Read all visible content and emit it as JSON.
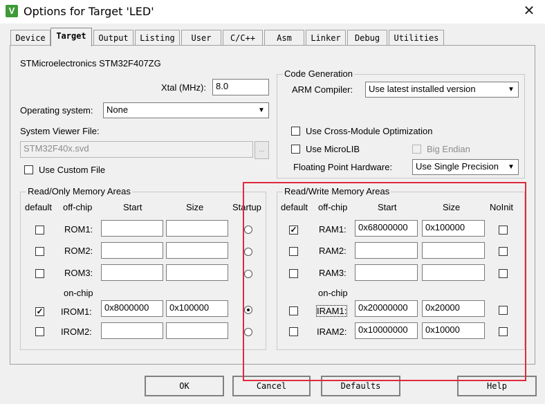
{
  "window": {
    "title": "Options for Target 'LED'",
    "app_icon_glyph": "V"
  },
  "tabs": [
    {
      "label": "Device"
    },
    {
      "label": "Target"
    },
    {
      "label": "Output"
    },
    {
      "label": "Listing"
    },
    {
      "label": "User"
    },
    {
      "label": "C/C++"
    },
    {
      "label": "Asm"
    },
    {
      "label": "Linker"
    },
    {
      "label": "Debug"
    },
    {
      "label": "Utilities"
    }
  ],
  "device": {
    "name": "STMicroelectronics STM32F407ZG",
    "xtal_label": "Xtal (MHz):",
    "xtal_value": "8.0",
    "os_label": "Operating system:",
    "os_value": "None",
    "svd_label": "System Viewer File:",
    "svd_value": "STM32F40x.svd",
    "browse_label": "...",
    "custom_file_label": "Use Custom File"
  },
  "code_gen": {
    "title": "Code Generation",
    "compiler_label": "ARM Compiler:",
    "compiler_value": "Use latest installed version",
    "cross_module_label": "Use Cross-Module Optimization",
    "microlib_label": "Use MicroLIB",
    "big_endian_label": "Big Endian",
    "fp_label": "Floating Point Hardware:",
    "fp_value": "Use Single Precision"
  },
  "rom": {
    "title": "Read/Only Memory Areas",
    "headers": {
      "default": "default",
      "offchip": "off-chip",
      "start": "Start",
      "size": "Size",
      "startup": "Startup"
    },
    "onchip_label": "on-chip",
    "rows": [
      {
        "name": "ROM1:",
        "start": "",
        "size": "",
        "default": "",
        "startup": false
      },
      {
        "name": "ROM2:",
        "start": "",
        "size": "",
        "default": "",
        "startup": false
      },
      {
        "name": "ROM3:",
        "start": "",
        "size": "",
        "default": "",
        "startup": false
      },
      {
        "name": "IROM1:",
        "start": "0x8000000",
        "size": "0x100000",
        "default": "✓",
        "startup": true
      },
      {
        "name": "IROM2:",
        "start": "",
        "size": "",
        "default": "",
        "startup": false
      }
    ]
  },
  "ram": {
    "title": "Read/Write Memory Areas",
    "headers": {
      "default": "default",
      "offchip": "off-chip",
      "start": "Start",
      "size": "Size",
      "noinit": "NoInit"
    },
    "onchip_label": "on-chip",
    "rows": [
      {
        "name": "RAM1:",
        "start": "0x68000000",
        "size": "0x100000",
        "default": "✓"
      },
      {
        "name": "RAM2:",
        "start": "",
        "size": "",
        "default": ""
      },
      {
        "name": "RAM3:",
        "start": "",
        "size": "",
        "default": ""
      },
      {
        "name": "IRAM1:",
        "start": "0x20000000",
        "size": "0x20000",
        "default": ""
      },
      {
        "name": "IRAM2:",
        "start": "0x10000000",
        "size": "0x10000",
        "default": ""
      }
    ]
  },
  "buttons": {
    "ok": "OK",
    "cancel": "Cancel",
    "defaults": "Defaults",
    "help": "Help"
  },
  "colors": {
    "highlight_box": "#e0283c",
    "app_icon": "#3e9b37"
  }
}
